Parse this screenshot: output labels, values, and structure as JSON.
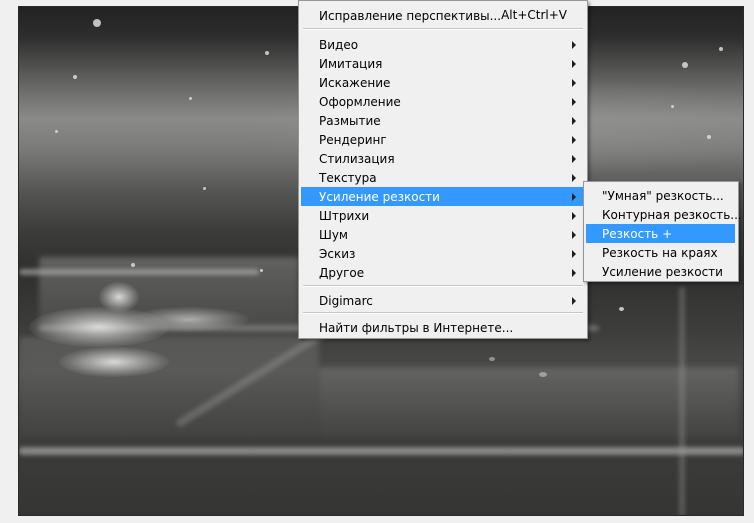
{
  "filter_menu": {
    "items": [
      {
        "label": "Исправление перспективы...",
        "shortcut": "Alt+Ctrl+V"
      },
      {
        "label": "Видео"
      },
      {
        "label": "Имитация"
      },
      {
        "label": "Искажение"
      },
      {
        "label": "Оформление"
      },
      {
        "label": "Размытие"
      },
      {
        "label": "Рендеринг"
      },
      {
        "label": "Стилизация"
      },
      {
        "label": "Текстура"
      },
      {
        "label": "Усиление резкости"
      },
      {
        "label": "Штрихи"
      },
      {
        "label": "Шум"
      },
      {
        "label": "Эскиз"
      },
      {
        "label": "Другое"
      },
      {
        "label": "Digimarc"
      },
      {
        "label": "Найти фильтры в Интернете..."
      }
    ],
    "highlighted": "Усиление резкости"
  },
  "sharpen_submenu": {
    "items": [
      {
        "label": "\"Умная\" резкость..."
      },
      {
        "label": "Контурная резкость..."
      },
      {
        "label": "Резкость +"
      },
      {
        "label": "Резкость на краях"
      },
      {
        "label": "Усиление резкости"
      }
    ],
    "highlighted": "Резкость +"
  },
  "colors": {
    "highlight": "#3399ff",
    "menu_background": "#f0f0f0",
    "menu_border": "#979797"
  }
}
